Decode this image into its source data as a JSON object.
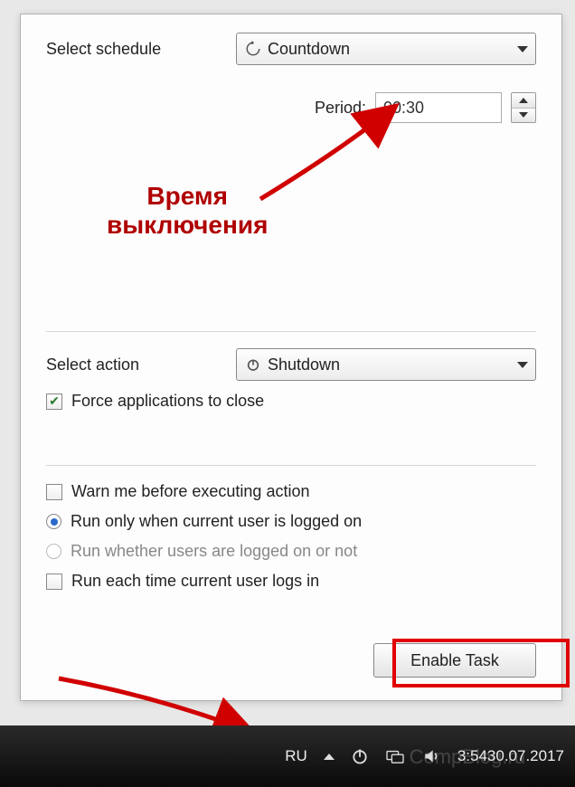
{
  "schedule": {
    "label": "Select schedule",
    "value": "Countdown"
  },
  "period": {
    "label": "Period:",
    "value": "00:30"
  },
  "annotation": {
    "line1": "Время",
    "line2": "выключения"
  },
  "action": {
    "label": "Select action",
    "value": "Shutdown"
  },
  "options": {
    "force_close": "Force applications to close",
    "warn": "Warn me before executing action",
    "run_only_user": "Run only when current user is logged on",
    "run_whether": "Run whether users are logged on or not",
    "run_each_login": "Run each time current user logs in"
  },
  "button": {
    "enable": "Enable Task"
  },
  "taskbar": {
    "lang": "RU",
    "time": "3:54",
    "date": "30.07.2017"
  },
  "watermark": "CompBlog.ru"
}
